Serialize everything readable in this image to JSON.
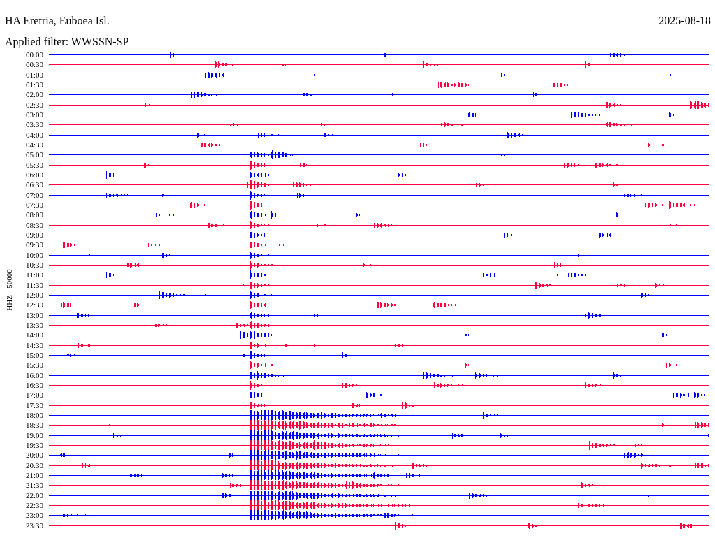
{
  "header": {
    "station": "HA Eretria, Euboea Isl.",
    "date": "2025-08-18",
    "filter": "Applied filter: WWSSN-SP"
  },
  "axis_label": "HHZ - 50000",
  "traces": [
    {
      "time": "00:00",
      "color": "#0000ff"
    },
    {
      "time": "00:30",
      "color": "#ff0040"
    },
    {
      "time": "01:00",
      "color": "#0000ff"
    },
    {
      "time": "01:30",
      "color": "#ff0040"
    },
    {
      "time": "02:00",
      "color": "#0000ff"
    },
    {
      "time": "02:30",
      "color": "#ff0040"
    },
    {
      "time": "03:00",
      "color": "#0000ff"
    },
    {
      "time": "03:30",
      "color": "#ff0040"
    },
    {
      "time": "04:00",
      "color": "#0000ff"
    },
    {
      "time": "04:30",
      "color": "#ff0040"
    },
    {
      "time": "05:00",
      "color": "#0000ff"
    },
    {
      "time": "05:30",
      "color": "#ff0040"
    },
    {
      "time": "06:00",
      "color": "#0000ff"
    },
    {
      "time": "06:30",
      "color": "#ff0040"
    },
    {
      "time": "07:00",
      "color": "#0000ff"
    },
    {
      "time": "07:30",
      "color": "#ff0040"
    },
    {
      "time": "08:00",
      "color": "#0000ff"
    },
    {
      "time": "08:30",
      "color": "#ff0040"
    },
    {
      "time": "09:00",
      "color": "#0000ff"
    },
    {
      "time": "09:30",
      "color": "#ff0040"
    },
    {
      "time": "10:00",
      "color": "#0000ff"
    },
    {
      "time": "10:30",
      "color": "#ff0040"
    },
    {
      "time": "11:00",
      "color": "#0000ff"
    },
    {
      "time": "11:30",
      "color": "#ff0040"
    },
    {
      "time": "12:00",
      "color": "#0000ff"
    },
    {
      "time": "12:30",
      "color": "#ff0040"
    },
    {
      "time": "13:00",
      "color": "#0000ff"
    },
    {
      "time": "13:30",
      "color": "#ff0040"
    },
    {
      "time": "14:00",
      "color": "#0000ff"
    },
    {
      "time": "14:30",
      "color": "#ff0040"
    },
    {
      "time": "15:00",
      "color": "#0000ff"
    },
    {
      "time": "15:30",
      "color": "#ff0040"
    },
    {
      "time": "16:00",
      "color": "#0000ff"
    },
    {
      "time": "16:30",
      "color": "#ff0040"
    },
    {
      "time": "17:00",
      "color": "#0000ff"
    },
    {
      "time": "17:30",
      "color": "#ff0040"
    },
    {
      "time": "18:00",
      "color": "#0000ff"
    },
    {
      "time": "18:30",
      "color": "#ff0040"
    },
    {
      "time": "19:00",
      "color": "#0000ff"
    },
    {
      "time": "19:30",
      "color": "#ff0040"
    },
    {
      "time": "20:00",
      "color": "#0000ff"
    },
    {
      "time": "20:30",
      "color": "#ff0040"
    },
    {
      "time": "21:00",
      "color": "#0000ff"
    },
    {
      "time": "21:30",
      "color": "#ff0040"
    },
    {
      "time": "22:00",
      "color": "#0000ff"
    },
    {
      "time": "22:30",
      "color": "#ff0040"
    },
    {
      "time": "23:00",
      "color": "#0000ff"
    },
    {
      "time": "23:30",
      "color": "#ff0040"
    }
  ]
}
